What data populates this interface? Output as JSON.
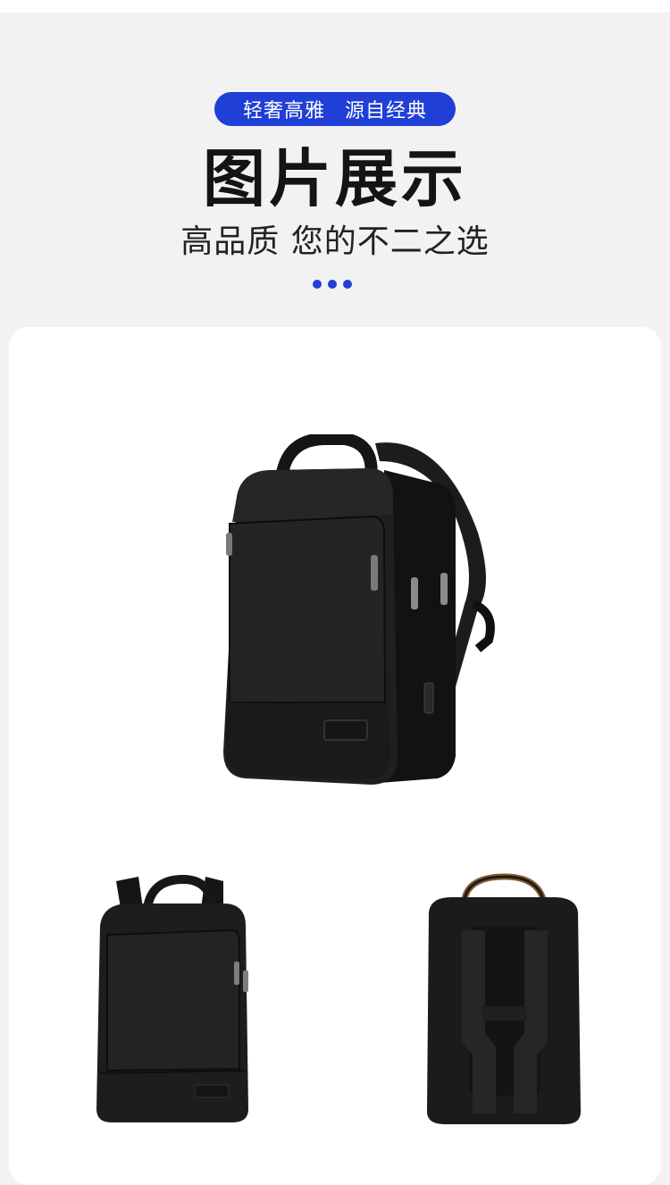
{
  "header": {
    "tag_left": "轻奢高雅",
    "tag_right": "源自经典",
    "title": "图片展示",
    "subtitle": "高品质 您的不二之选"
  },
  "colors": {
    "accent": "#1f3fd6",
    "page_background": "#f2f2f2",
    "card_background": "#ffffff",
    "product": "#1a1a1a"
  },
  "gallery": {
    "images": [
      {
        "name": "backpack-main-angled-view",
        "icon": "backpack-icon"
      },
      {
        "name": "backpack-front-view",
        "icon": "backpack-icon"
      },
      {
        "name": "backpack-back-view",
        "icon": "backpack-icon"
      }
    ]
  }
}
